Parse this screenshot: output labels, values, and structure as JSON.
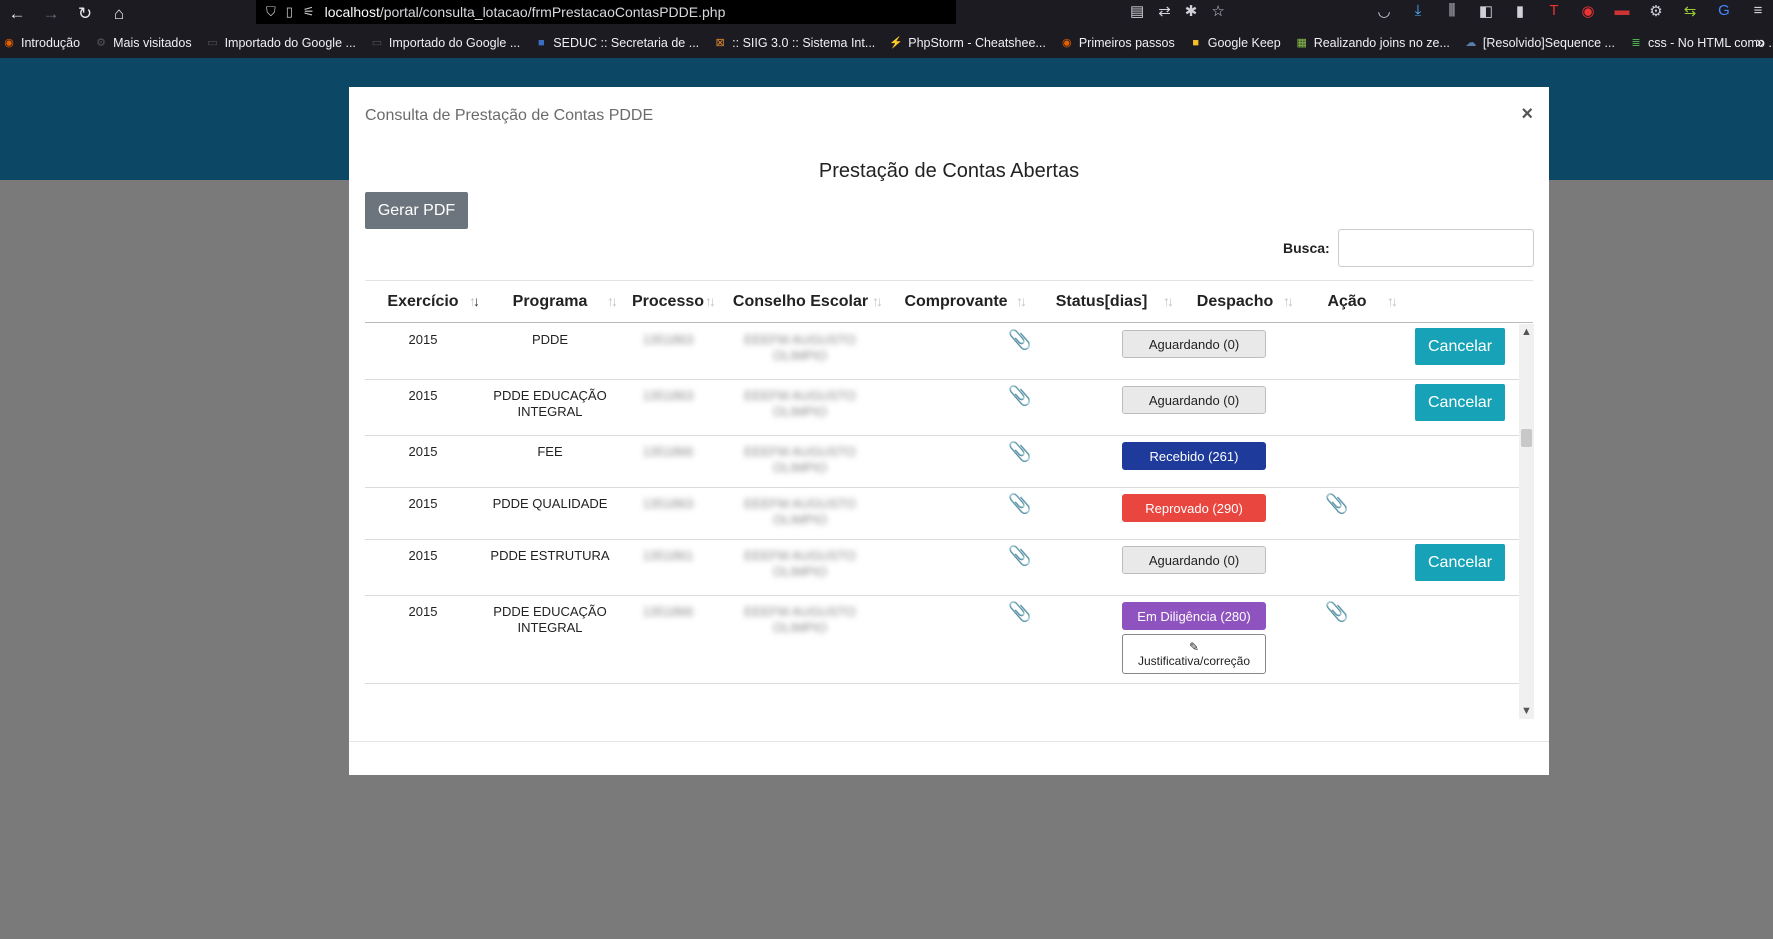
{
  "browser": {
    "url_host": "localhost",
    "url_path": "/portal/consulta_lotacao/frmPrestacaoContasPDDE.php",
    "bookmarks": [
      {
        "label": "Introdução",
        "icon": "firefox-icon",
        "color": "#e66000"
      },
      {
        "label": "Mais visitados",
        "icon": "gear-icon",
        "color": "#555555"
      },
      {
        "label": "Importado do Google ...",
        "icon": "folder-icon",
        "color": "#555555"
      },
      {
        "label": "Importado do Google ...",
        "icon": "folder-icon",
        "color": "#555555"
      },
      {
        "label": "SEDUC :: Secretaria de ...",
        "icon": "seduc-icon",
        "color": "#3a6fc4"
      },
      {
        "label": ":: SIIG 3.0 :: Sistema Int...",
        "icon": "siig-icon",
        "color": "#e08a2e"
      },
      {
        "label": "PhpStorm - Cheatshee...",
        "icon": "phpstorm-icon",
        "color": "#7a3cff"
      },
      {
        "label": "Primeiros passos",
        "icon": "firefox-icon",
        "color": "#e66000"
      },
      {
        "label": "Google Keep",
        "icon": "keep-icon",
        "color": "#f6bf26"
      },
      {
        "label": "Realizando joins no ze...",
        "icon": "grid-icon",
        "color": "#8bc34a"
      },
      {
        "label": "[Resolvido]Sequence ...",
        "icon": "cloud-icon",
        "color": "#5a7ea8"
      },
      {
        "label": "css - No HTML como ...",
        "icon": "stack-icon",
        "color": "#4caf50"
      }
    ]
  },
  "modal": {
    "title": "Consulta de Prestação de Contas PDDE",
    "close_label": "×",
    "section_title": "Prestação de Contas Abertas",
    "pdf_button": "Gerar PDF",
    "search_label": "Busca:",
    "columns": [
      "Exercício",
      "Programa",
      "Processo",
      "Conselho Escolar",
      "Comprovante",
      "Status[dias]",
      "Despacho",
      "Ação"
    ],
    "rows": [
      {
        "exercicio": "2015",
        "programa": "PDDE",
        "processo": "1351863",
        "conselho": "EEEFM AUGUSTO OLIMPIO",
        "status": "Aguardando (0)",
        "status_type": "aguardando",
        "despacho": false,
        "acao": "Cancelar",
        "justificativa": ""
      },
      {
        "exercicio": "2015",
        "programa": "PDDE EDUCAÇÃO INTEGRAL",
        "processo": "1351863",
        "conselho": "EEEFM AUGUSTO OLIMPIO",
        "status": "Aguardando (0)",
        "status_type": "aguardando",
        "despacho": false,
        "acao": "Cancelar",
        "justificativa": ""
      },
      {
        "exercicio": "2015",
        "programa": "FEE",
        "processo": "1351866",
        "conselho": "EEEFM AUGUSTO OLIMPIO",
        "status": "Recebido (261)",
        "status_type": "recebido",
        "despacho": false,
        "acao": "",
        "justificativa": ""
      },
      {
        "exercicio": "2015",
        "programa": "PDDE QUALIDADE",
        "processo": "1351863",
        "conselho": "EEEFM AUGUSTO OLIMPIO",
        "status": "Reprovado (290)",
        "status_type": "reprovado",
        "despacho": true,
        "acao": "",
        "justificativa": ""
      },
      {
        "exercicio": "2015",
        "programa": "PDDE ESTRUTURA",
        "processo": "1351861",
        "conselho": "EEEFM AUGUSTO OLIMPIO",
        "status": "Aguardando (0)",
        "status_type": "aguardando",
        "despacho": false,
        "acao": "Cancelar",
        "justificativa": ""
      },
      {
        "exercicio": "2015",
        "programa": "PDDE EDUCAÇÃO INTEGRAL",
        "processo": "1351866",
        "conselho": "EEEFM AUGUSTO OLIMPIO",
        "status": "Em Diligência (280)",
        "status_type": "diligencia",
        "despacho": true,
        "acao": "",
        "justificativa": "Justificativa/correção"
      }
    ]
  }
}
